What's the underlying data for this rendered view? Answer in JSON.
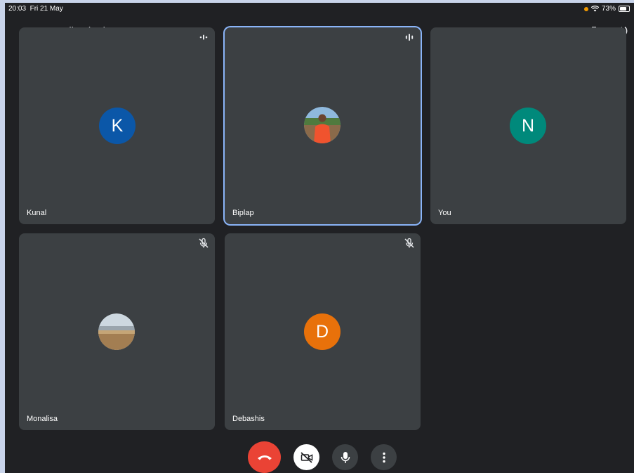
{
  "status_bar": {
    "time": "20:03",
    "date": "Fri 21 May",
    "battery": "73%",
    "battery_level": 0.73
  },
  "meeting": {
    "code": "wry-diux-bxd"
  },
  "participants": [
    {
      "name": "Kunal",
      "initial": "K",
      "avatar_color": "#0b57a8",
      "state": "speaking-indicator"
    },
    {
      "name": "Biplap",
      "initial": "",
      "avatar": "photo",
      "state": "speaking-indicator",
      "active": true
    },
    {
      "name": "You",
      "initial": "N",
      "avatar_color": "#00897b",
      "state": "none"
    },
    {
      "name": "Monalisa",
      "initial": "",
      "avatar": "photo",
      "state": "muted"
    },
    {
      "name": "Debashis",
      "initial": "D",
      "avatar_color": "#e8710a",
      "state": "muted"
    }
  ],
  "controls": {
    "end_call_color": "#ea4335",
    "icons": [
      "phone-hangup-icon",
      "camera-off-icon",
      "microphone-icon",
      "more-vert-icon"
    ]
  },
  "colors": {
    "background": "#202124",
    "tile": "#3c4043",
    "active_border": "#8ab4f8"
  }
}
